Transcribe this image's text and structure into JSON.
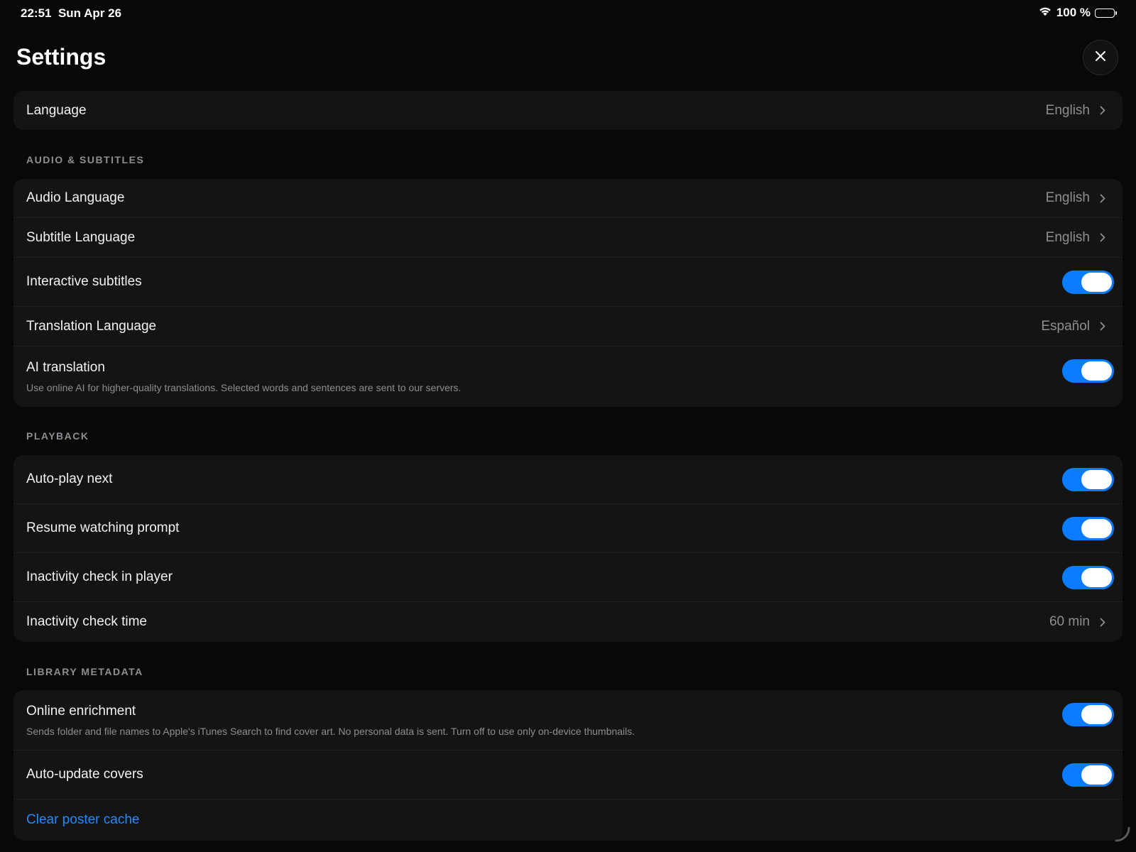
{
  "status_bar": {
    "time": "22:51",
    "date": "Sun Apr 26",
    "battery_text": "100 %",
    "wifi_icon": "wifi-icon",
    "battery_icon": "battery-icon"
  },
  "header": {
    "title": "Settings",
    "close_icon": "close-icon"
  },
  "general": {
    "language": {
      "label": "Language",
      "value": "English"
    }
  },
  "audio_subtitles": {
    "header": "AUDIO & SUBTITLES",
    "audio_language": {
      "label": "Audio Language",
      "value": "English"
    },
    "subtitle_language": {
      "label": "Subtitle Language",
      "value": "English"
    },
    "interactive_subtitles": {
      "label": "Interactive subtitles",
      "enabled": true
    },
    "translation_language": {
      "label": "Translation Language",
      "value": "Español"
    },
    "ai_translation": {
      "label": "AI translation",
      "description": "Use online AI for higher-quality translations. Selected words and sentences are sent to our servers.",
      "enabled": true
    }
  },
  "playback": {
    "header": "PLAYBACK",
    "auto_play_next": {
      "label": "Auto-play next",
      "enabled": true
    },
    "resume_watching_prompt": {
      "label": "Resume watching prompt",
      "enabled": true
    },
    "inactivity_check": {
      "label": "Inactivity check in player",
      "enabled": true
    },
    "inactivity_check_time": {
      "label": "Inactivity check time",
      "value": "60 min"
    }
  },
  "library_metadata": {
    "header": "LIBRARY METADATA",
    "online_enrichment": {
      "label": "Online enrichment",
      "description": "Sends folder and file names to Apple's iTunes Search to find cover art. No personal data is sent. Turn off to use only on-device thumbnails.",
      "enabled": true
    },
    "auto_update_covers": {
      "label": "Auto-update covers",
      "enabled": true
    },
    "clear_poster_cache": {
      "label": "Clear poster cache"
    }
  },
  "colors": {
    "background": "#080808",
    "card": "#141414",
    "accent": "#0a7cff",
    "link": "#1f8bff",
    "secondary_text": "#8e8e93"
  }
}
